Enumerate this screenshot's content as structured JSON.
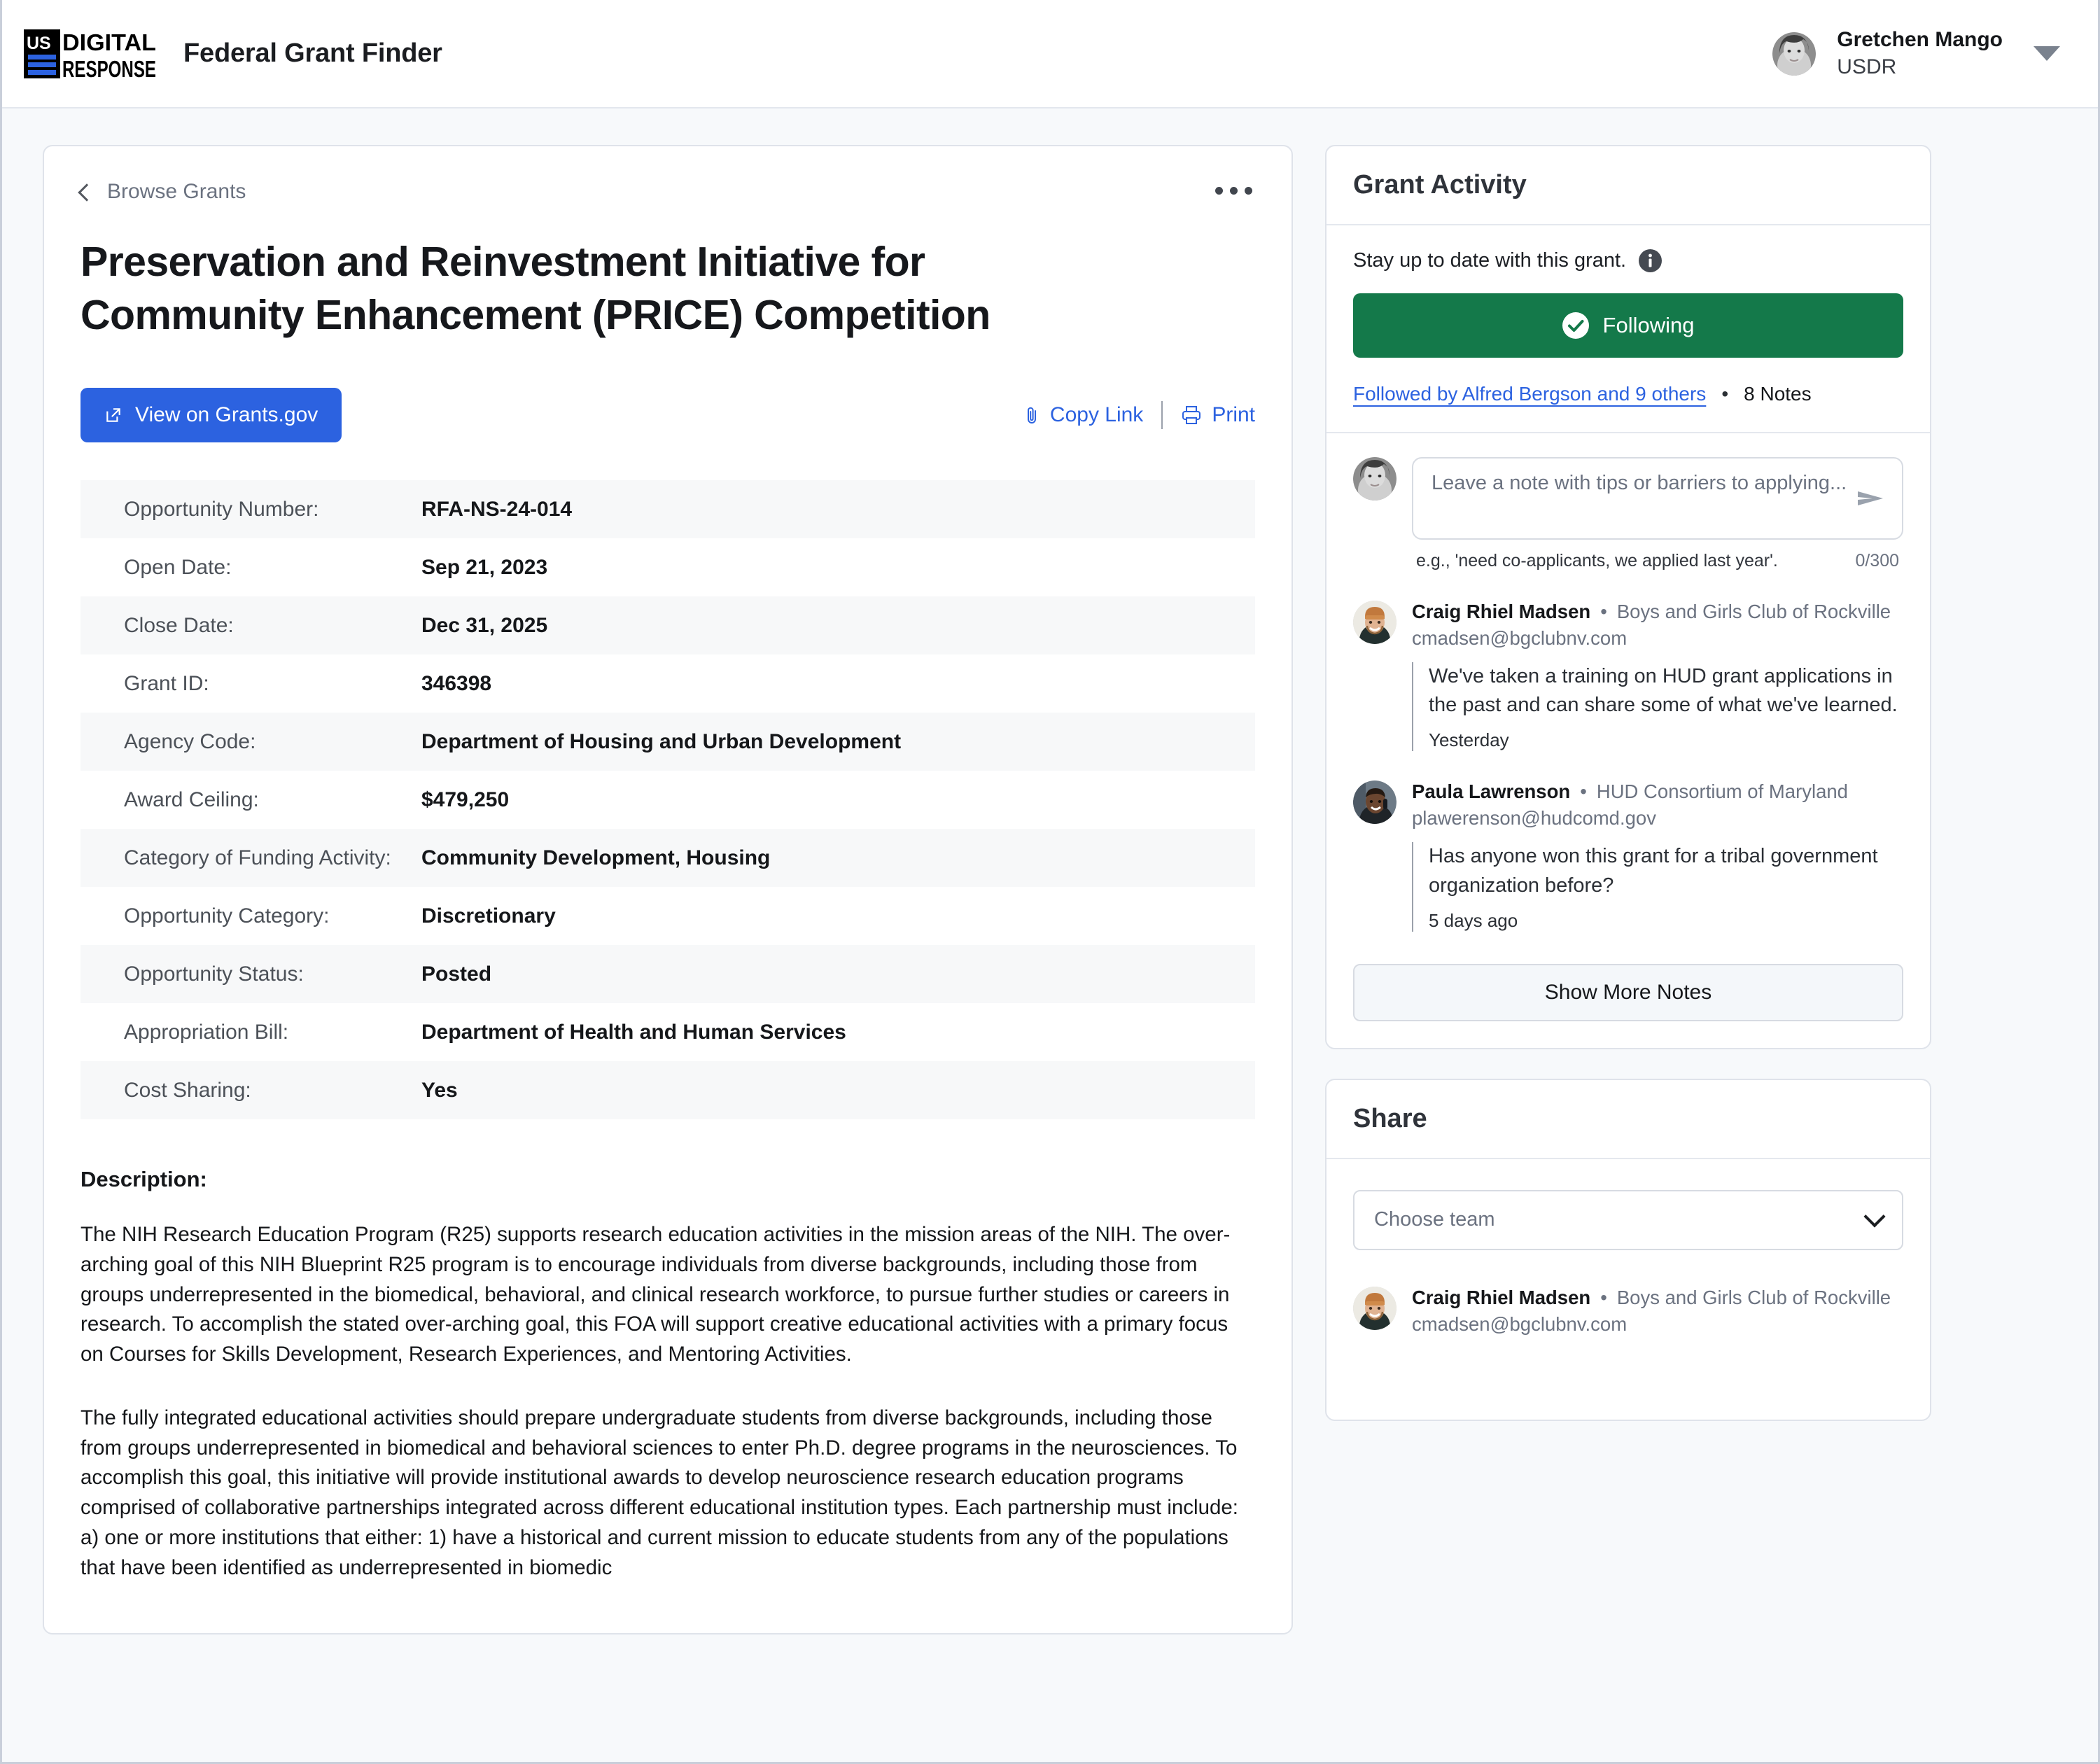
{
  "header": {
    "logo_alt": "US Digital Response",
    "app_title": "Federal Grant Finder",
    "user": {
      "name": "Gretchen Mango",
      "org": "USDR"
    }
  },
  "main": {
    "breadcrumb": "Browse Grants",
    "title": "Preservation and Reinvestment Initiative for Community Enhancement (PRICE) Competition",
    "primary_action": "View on Grants.gov",
    "copy_link": "Copy Link",
    "print": "Print",
    "details": [
      {
        "key": "Opportunity Number:",
        "value": "RFA-NS-24-014"
      },
      {
        "key": "Open Date:",
        "value": "Sep 21, 2023"
      },
      {
        "key": "Close Date:",
        "value": "Dec 31, 2025"
      },
      {
        "key": "Grant ID:",
        "value": "346398"
      },
      {
        "key": "Agency Code:",
        "value": "Department of Housing and Urban Development"
      },
      {
        "key": "Award Ceiling:",
        "value": "$479,250"
      },
      {
        "key": "Category of Funding Activity:",
        "value": "Community Development, Housing"
      },
      {
        "key": "Opportunity Category:",
        "value": "Discretionary"
      },
      {
        "key": "Opportunity Status:",
        "value": "Posted"
      },
      {
        "key": "Appropriation Bill:",
        "value": "Department of Health and Human Services"
      },
      {
        "key": "Cost Sharing:",
        "value": "Yes"
      }
    ],
    "description_label": "Description:",
    "description_paragraphs": [
      "The NIH Research Education Program (R25) supports research education activities in the mission areas of the NIH. The over-arching goal of this NIH Blueprint R25 program is to encourage individuals from diverse backgrounds, including those from groups underrepresented in the biomedical, behavioral, and clinical research workforce, to pursue further studies or careers in research. To accomplish the stated over-arching goal, this FOA will support creative educational activities with a primary focus on Courses for Skills Development, Research Experiences, and Mentoring Activities.",
      "The fully integrated educational activities should prepare undergraduate students from diverse backgrounds, including those from groups underrepresented in biomedical and behavioral sciences to enter Ph.D. degree programs in the neurosciences. To accomplish this goal, this initiative will provide institutional awards to develop neuroscience research education programs comprised of collaborative partnerships integrated across different educational institution types. Each partnership must include: a) one or more institutions that either: 1) have a historical and current mission to educate students from any of the populations that have been identified as underrepresented in biomedic"
    ]
  },
  "activity": {
    "panel_title": "Grant Activity",
    "stay_text": "Stay up to date with this grant.",
    "follow_button": "Following",
    "followed_by": "Followed by Alfred Bergson and 9 others",
    "separator": "•",
    "notes_count": "8 Notes",
    "composer": {
      "placeholder": "Leave a note with tips or barriers to applying...",
      "hint": "e.g., 'need co-applicants, we applied last year'.",
      "counter": "0/300"
    },
    "notes": [
      {
        "author": "Craig Rhiel Madsen",
        "sep": "•",
        "org": "Boys and Girls Club of Rockville",
        "email": "cmadsen@bgclubnv.com",
        "text": "We've taken a training on HUD grant applications in the past and can share some of what we've learned.",
        "time": "Yesterday"
      },
      {
        "author": "Paula Lawrenson",
        "sep": "•",
        "org": "HUD Consortium of Maryland",
        "email": "plawerenson@hudcomd.gov",
        "text": "Has anyone won this grant for a tribal government organization before?",
        "time": "5 days ago"
      }
    ],
    "show_more": "Show More Notes"
  },
  "share": {
    "panel_title": "Share",
    "select_placeholder": "Choose team",
    "person": {
      "name": "Craig Rhiel Madsen",
      "sep": "•",
      "org": "Boys and Girls Club of Rockville",
      "email": "cmadsen@bgclubnv.com"
    }
  },
  "colors": {
    "accent_blue": "#2c62e0",
    "follow_green": "#14794a",
    "page_bg": "#f7f9fb",
    "muted": "#6b7280"
  }
}
